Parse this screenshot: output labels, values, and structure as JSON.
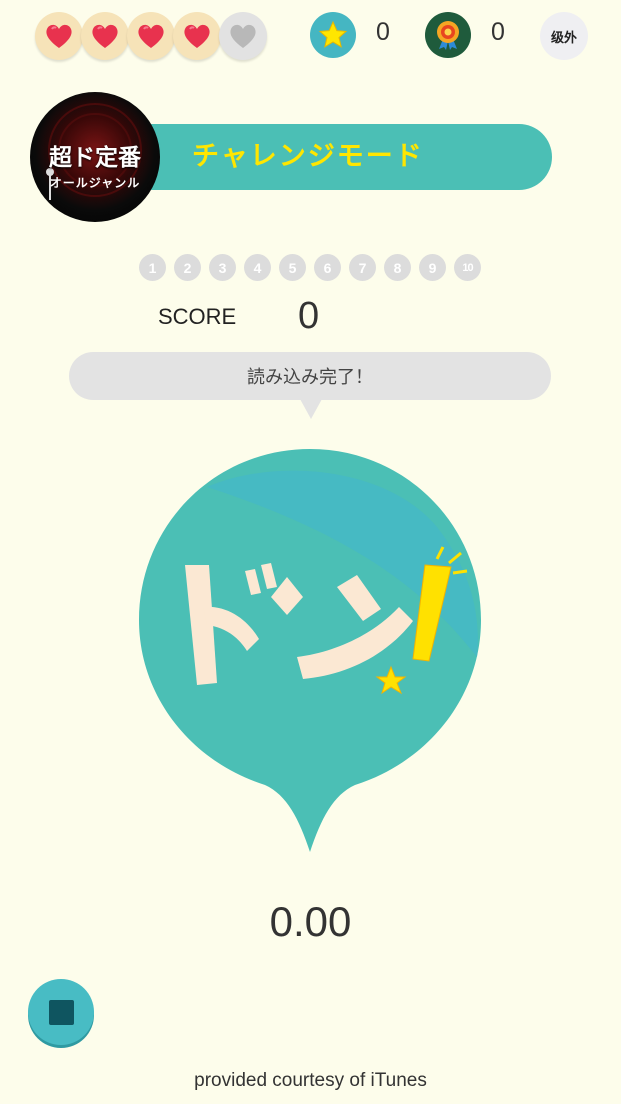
{
  "lives": {
    "total": 5,
    "remaining": 4
  },
  "stats": {
    "stars": "0",
    "medals": "0",
    "rank": "级外"
  },
  "mode": {
    "title": "チャレンジモード"
  },
  "genre": {
    "name": "超ド定番",
    "sub": "オールジャンル"
  },
  "progress": {
    "questions": [
      "1",
      "2",
      "3",
      "4",
      "5",
      "6",
      "7",
      "8",
      "9",
      "10"
    ],
    "current": 0
  },
  "score": {
    "label": "SCORE",
    "value": "0"
  },
  "status": {
    "message": "読み込み完了！"
  },
  "don_button": {
    "text": "ドン!",
    "colors": {
      "bg": "#4bbfb5",
      "letters": "#fbe8d3",
      "accent": "#ffe100"
    }
  },
  "timer": {
    "value": "0.00"
  },
  "footer": {
    "credit": "provided courtesy of iTunes"
  },
  "colors": {
    "background": "#fdfdeb",
    "teal": "#4bbfb5",
    "yellow": "#ffe600"
  }
}
